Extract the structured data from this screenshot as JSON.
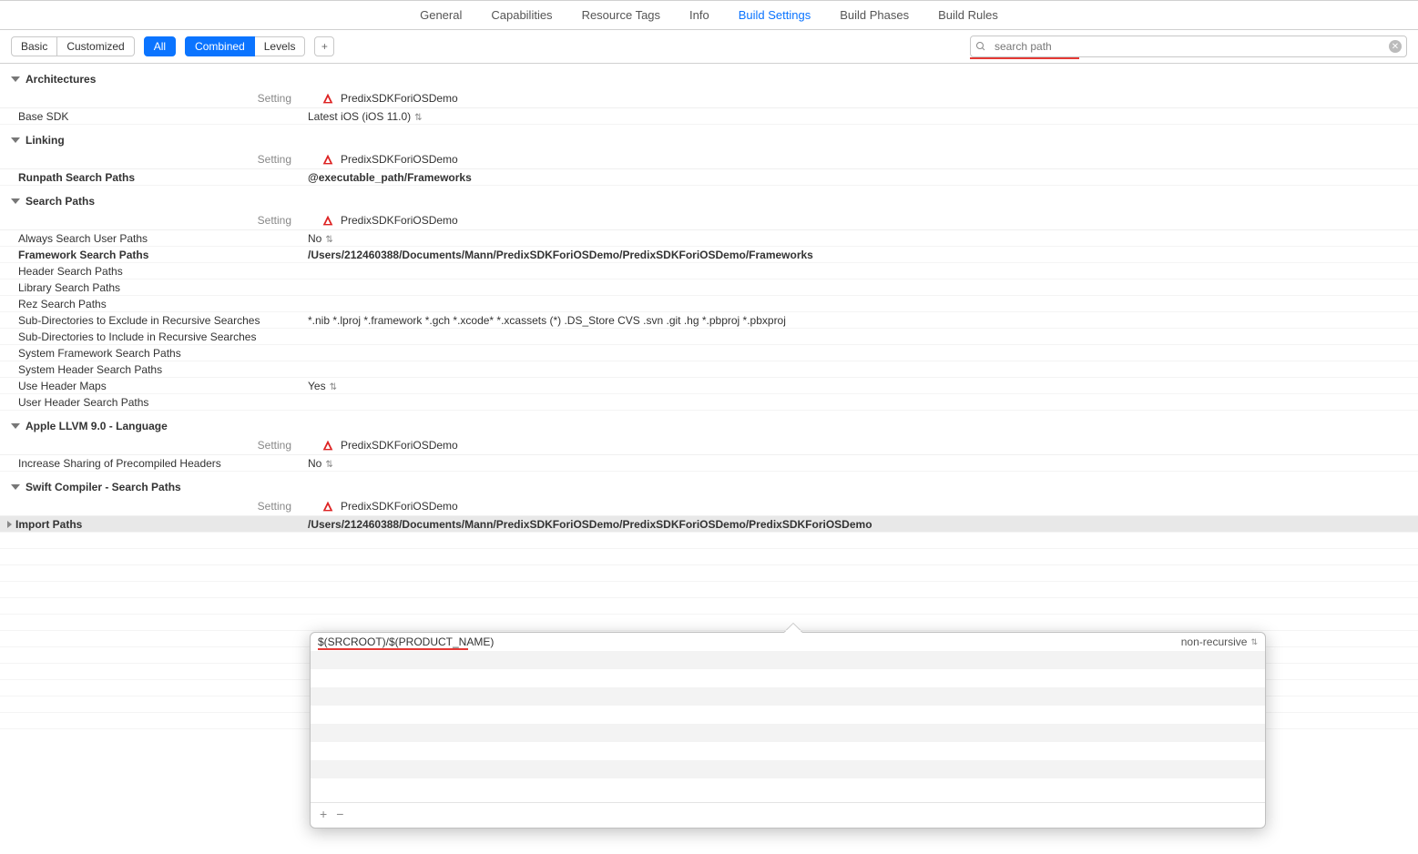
{
  "tabs": {
    "items": [
      {
        "label": "General"
      },
      {
        "label": "Capabilities"
      },
      {
        "label": "Resource Tags"
      },
      {
        "label": "Info"
      },
      {
        "label": "Build Settings",
        "active": true
      },
      {
        "label": "Build Phases"
      },
      {
        "label": "Build Rules"
      }
    ]
  },
  "toolbar": {
    "basic": "Basic",
    "customized": "Customized",
    "all": "All",
    "combined": "Combined",
    "levels": "Levels",
    "search_value": "search path"
  },
  "column_header_label": "Setting",
  "target_name": "PredixSDKForiOSDemo",
  "sections": {
    "architectures": {
      "title": "Architectures",
      "rows": [
        {
          "name": "Base SDK",
          "value": "Latest iOS (iOS 11.0)",
          "updown": true
        }
      ]
    },
    "linking": {
      "title": "Linking",
      "rows": [
        {
          "name": "Runpath Search Paths",
          "bold": true,
          "value": "@executable_path/Frameworks",
          "vbold": true
        }
      ]
    },
    "search_paths": {
      "title": "Search Paths",
      "rows": [
        {
          "name": "Always Search User Paths",
          "value": "No",
          "updown": true
        },
        {
          "name": "Framework Search Paths",
          "bold": true,
          "value": "/Users/212460388/Documents/Mann/PredixSDKForiOSDemo/PredixSDKForiOSDemo/Frameworks",
          "vbold": true
        },
        {
          "name": "Header Search Paths",
          "value": ""
        },
        {
          "name": "Library Search Paths",
          "value": ""
        },
        {
          "name": "Rez Search Paths",
          "value": ""
        },
        {
          "name": "Sub-Directories to Exclude in Recursive Searches",
          "value": "*.nib *.lproj *.framework *.gch *.xcode* *.xcassets (*) .DS_Store CVS .svn .git .hg *.pbproj *.pbxproj"
        },
        {
          "name": "Sub-Directories to Include in Recursive Searches",
          "value": ""
        },
        {
          "name": "System Framework Search Paths",
          "value": ""
        },
        {
          "name": "System Header Search Paths",
          "value": ""
        },
        {
          "name": "Use Header Maps",
          "value": "Yes",
          "updown": true
        },
        {
          "name": "User Header Search Paths",
          "value": ""
        }
      ]
    },
    "llvm": {
      "title": "Apple LLVM 9.0 - Language",
      "rows": [
        {
          "name": "Increase Sharing of Precompiled Headers",
          "value": "No",
          "updown": true
        }
      ]
    },
    "swift": {
      "title": "Swift Compiler - Search Paths",
      "rows": [
        {
          "name": "Import Paths",
          "bold": true,
          "value": "/Users/212460388/Documents/Mann/PredixSDKForiOSDemo/PredixSDKForiOSDemo/PredixSDKForiOSDemo",
          "vbold": true,
          "disclosure": true,
          "highlighted": true
        }
      ]
    }
  },
  "popover": {
    "path": "$(SRCROOT)/$(PRODUCT_NAME)",
    "recursive": "non-recursive"
  }
}
